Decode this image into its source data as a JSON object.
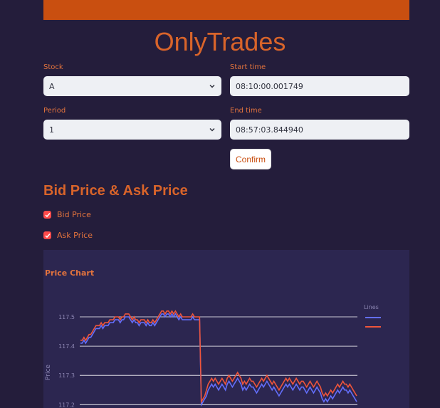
{
  "app": {
    "title": "OnlyTrades"
  },
  "form": {
    "stock_label": "Stock",
    "stock_value": "A",
    "start_label": "Start time",
    "start_value": "08:10:00.001749",
    "period_label": "Period",
    "period_value": "1",
    "end_label": "End time",
    "end_value": "08:57:03.844940",
    "confirm_label": "Confirm"
  },
  "section": {
    "title": "Bid Price & Ask Price",
    "checkbox_bid": "Bid Price",
    "checkbox_ask": "Ask Price"
  },
  "colors": {
    "accent": "#c94f10",
    "bid": "#636efa",
    "ask": "#ef553b",
    "checkbox": "#ff4b4b"
  },
  "chart_data": {
    "type": "line",
    "title": "Price Chart",
    "ylabel": "Price",
    "legend_title": "Lines",
    "legend_position": "top-right",
    "ylim": [
      117.2,
      117.55
    ],
    "yticks": [
      "117.5",
      "117.4",
      "117.3",
      "117.2"
    ],
    "grid": true,
    "series": [
      {
        "color": "#636efa",
        "values": [
          117.41,
          117.41,
          117.42,
          117.41,
          117.42,
          117.43,
          117.43,
          117.44,
          117.45,
          117.46,
          117.46,
          117.46,
          117.47,
          117.46,
          117.47,
          117.47,
          117.47,
          117.48,
          117.48,
          117.48,
          117.49,
          117.49,
          117.49,
          117.48,
          117.49,
          117.49,
          117.5,
          117.5,
          117.5,
          117.49,
          117.48,
          117.49,
          117.48,
          117.48,
          117.47,
          117.48,
          117.48,
          117.48,
          117.47,
          117.48,
          117.47,
          117.47,
          117.48,
          117.47,
          117.48,
          117.49,
          117.5,
          117.51,
          117.51,
          117.5,
          117.51,
          117.51,
          117.5,
          117.51,
          117.5,
          117.51,
          117.5,
          117.49,
          117.5,
          117.49,
          117.49,
          117.49,
          117.49,
          117.49,
          117.49,
          117.5,
          117.49,
          117.49,
          117.49,
          117.49,
          117.2,
          117.21,
          117.22,
          117.23,
          117.25,
          117.26,
          117.27,
          117.26,
          117.27,
          117.26,
          117.25,
          117.26,
          117.27,
          117.26,
          117.25,
          117.27,
          117.28,
          117.27,
          117.26,
          117.27,
          117.28,
          117.29,
          117.28,
          117.27,
          117.25,
          117.26,
          117.25,
          117.26,
          117.27,
          117.26,
          117.26,
          117.25,
          117.24,
          117.25,
          117.26,
          117.27,
          117.26,
          117.27,
          117.28,
          117.27,
          117.26,
          117.25,
          117.26,
          117.25,
          117.24,
          117.23,
          117.24,
          117.25,
          117.26,
          117.27,
          117.26,
          117.27,
          117.26,
          117.25,
          117.26,
          117.27,
          117.26,
          117.25,
          117.26,
          117.26,
          117.25,
          117.24,
          117.25,
          117.26,
          117.25,
          117.24,
          117.25,
          117.26,
          117.25,
          117.24,
          117.22,
          117.21,
          117.22,
          117.21,
          117.22,
          117.23,
          117.22,
          117.23,
          117.24,
          117.25,
          117.24,
          117.25,
          117.26,
          117.25,
          117.25,
          117.24,
          117.25,
          117.24,
          117.23,
          117.22,
          117.21
        ]
      },
      {
        "color": "#ef553b",
        "values": [
          117.42,
          117.42,
          117.43,
          117.42,
          117.43,
          117.44,
          117.44,
          117.45,
          117.46,
          117.47,
          117.47,
          117.47,
          117.48,
          117.47,
          117.48,
          117.48,
          117.48,
          117.49,
          117.49,
          117.49,
          117.5,
          117.5,
          117.5,
          117.49,
          117.5,
          117.5,
          117.51,
          117.51,
          117.51,
          117.5,
          117.49,
          117.5,
          117.49,
          117.49,
          117.48,
          117.49,
          117.49,
          117.49,
          117.48,
          117.49,
          117.48,
          117.48,
          117.49,
          117.48,
          117.49,
          117.5,
          117.51,
          117.52,
          117.52,
          117.51,
          117.52,
          117.52,
          117.51,
          117.52,
          117.51,
          117.52,
          117.51,
          117.5,
          117.51,
          117.5,
          117.5,
          117.5,
          117.5,
          117.5,
          117.5,
          117.51,
          117.5,
          117.5,
          117.5,
          117.5,
          117.21,
          117.22,
          117.23,
          117.25,
          117.27,
          117.28,
          117.29,
          117.28,
          117.29,
          117.28,
          117.27,
          117.28,
          117.29,
          117.28,
          117.27,
          117.29,
          117.3,
          117.29,
          117.28,
          117.29,
          117.3,
          117.31,
          117.3,
          117.29,
          117.27,
          117.28,
          117.27,
          117.28,
          117.29,
          117.28,
          117.28,
          117.27,
          117.26,
          117.27,
          117.28,
          117.29,
          117.28,
          117.29,
          117.3,
          117.29,
          117.28,
          117.27,
          117.28,
          117.27,
          117.26,
          117.25,
          117.26,
          117.27,
          117.28,
          117.29,
          117.28,
          117.29,
          117.28,
          117.27,
          117.28,
          117.29,
          117.28,
          117.27,
          117.28,
          117.28,
          117.27,
          117.26,
          117.27,
          117.28,
          117.27,
          117.26,
          117.27,
          117.28,
          117.27,
          117.26,
          117.24,
          117.23,
          117.24,
          117.23,
          117.24,
          117.25,
          117.24,
          117.25,
          117.26,
          117.27,
          117.26,
          117.27,
          117.28,
          117.27,
          117.27,
          117.26,
          117.27,
          117.26,
          117.25,
          117.24,
          117.23
        ]
      }
    ]
  }
}
